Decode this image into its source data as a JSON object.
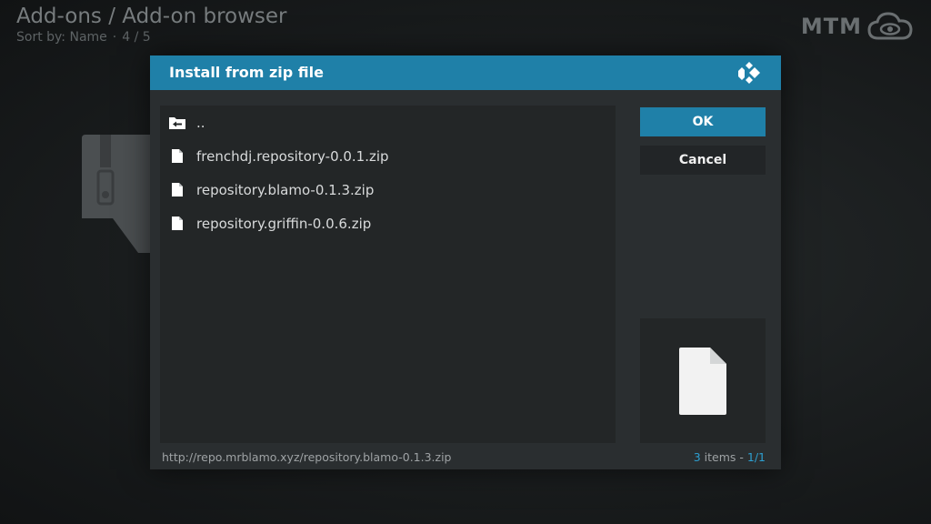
{
  "background": {
    "title": "Add-ons / Add-on browser",
    "sort_label": "Sort by: Name",
    "separator": "·",
    "position": "4 / 5",
    "brand": "MTM"
  },
  "dialog": {
    "title": "Install from zip file",
    "ok_label": "OK",
    "cancel_label": "Cancel",
    "files": [
      {
        "name": "..",
        "icon": "parent-folder-icon"
      },
      {
        "name": "frenchdj.repository-0.0.1.zip",
        "icon": "file-icon"
      },
      {
        "name": "repository.blamo-0.1.3.zip",
        "icon": "file-icon"
      },
      {
        "name": "repository.griffin-0.0.6.zip",
        "icon": "file-icon"
      }
    ],
    "footer_path": "http://repo.mrblamo.xyz/repository.blamo-0.1.3.zip",
    "item_count": "3",
    "items_text": " items - ",
    "page": "1/1"
  },
  "colors": {
    "accent": "#1f80a8",
    "count_accent": "#2d9fd0",
    "dialog_bg": "#2a2e30",
    "list_bg": "#232627"
  }
}
